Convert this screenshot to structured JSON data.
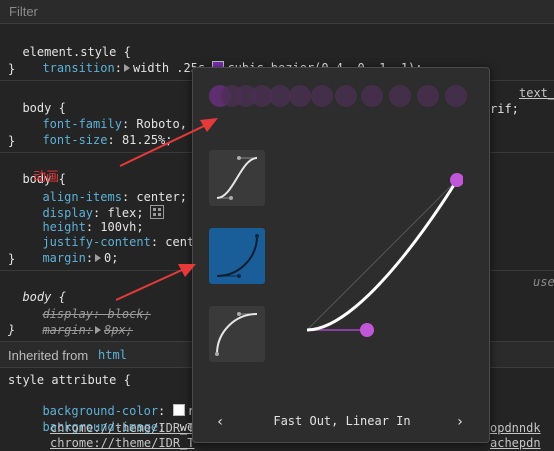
{
  "filter": {
    "placeholder": "Filter"
  },
  "rules": {
    "element_style": {
      "selector": "element.style",
      "prop": "transition",
      "value_pre": "width .25s",
      "value_post": "cubic-bezier(0.4, 0, 1, 1);"
    },
    "body1": {
      "selector": "body",
      "source": "text_",
      "lines": [
        {
          "prop": "font-family",
          "value": "Roboto, 'S",
          "tail": "rif;"
        },
        {
          "prop": "font-size",
          "value": "81.25%;"
        }
      ]
    },
    "body2": {
      "selector": "body",
      "annotation": "动画",
      "lines": [
        {
          "prop": "align-items",
          "value": "center;"
        },
        {
          "prop": "display",
          "value": "flex;"
        },
        {
          "prop": "height",
          "value": "100vh;"
        },
        {
          "prop": "justify-content",
          "value": "center"
        },
        {
          "prop": "margin",
          "value": "0;"
        }
      ]
    },
    "body3": {
      "selector": "body",
      "source": "use",
      "lines": [
        {
          "prop": "display",
          "value": "block;"
        },
        {
          "prop": "margin",
          "value": "8px;"
        }
      ]
    }
  },
  "inherited": {
    "label": "Inherited from",
    "tag": "html"
  },
  "style_attribute": {
    "selector": "style attribute {",
    "lines": [
      {
        "prop": "background-color",
        "value": "rgb"
      },
      {
        "prop": "background-image",
        "value": "-webk"
      }
    ],
    "urls": [
      "chrome://theme/IDR_T",
      "chrome://theme/IDR_T"
    ],
    "url_tails": [
      "opdnndk",
      "achepdn"
    ]
  },
  "popover": {
    "preset_name": "Fast Out, Linear In",
    "prev_icon": "chevron-left-icon",
    "next_icon": "chevron-right-icon",
    "accent": "#c157d8",
    "selected_preset_bg": "#1a5e99"
  },
  "colors": {
    "background": "#242424",
    "property": "#5db0d7",
    "annotation_red": "#e63a3a"
  }
}
